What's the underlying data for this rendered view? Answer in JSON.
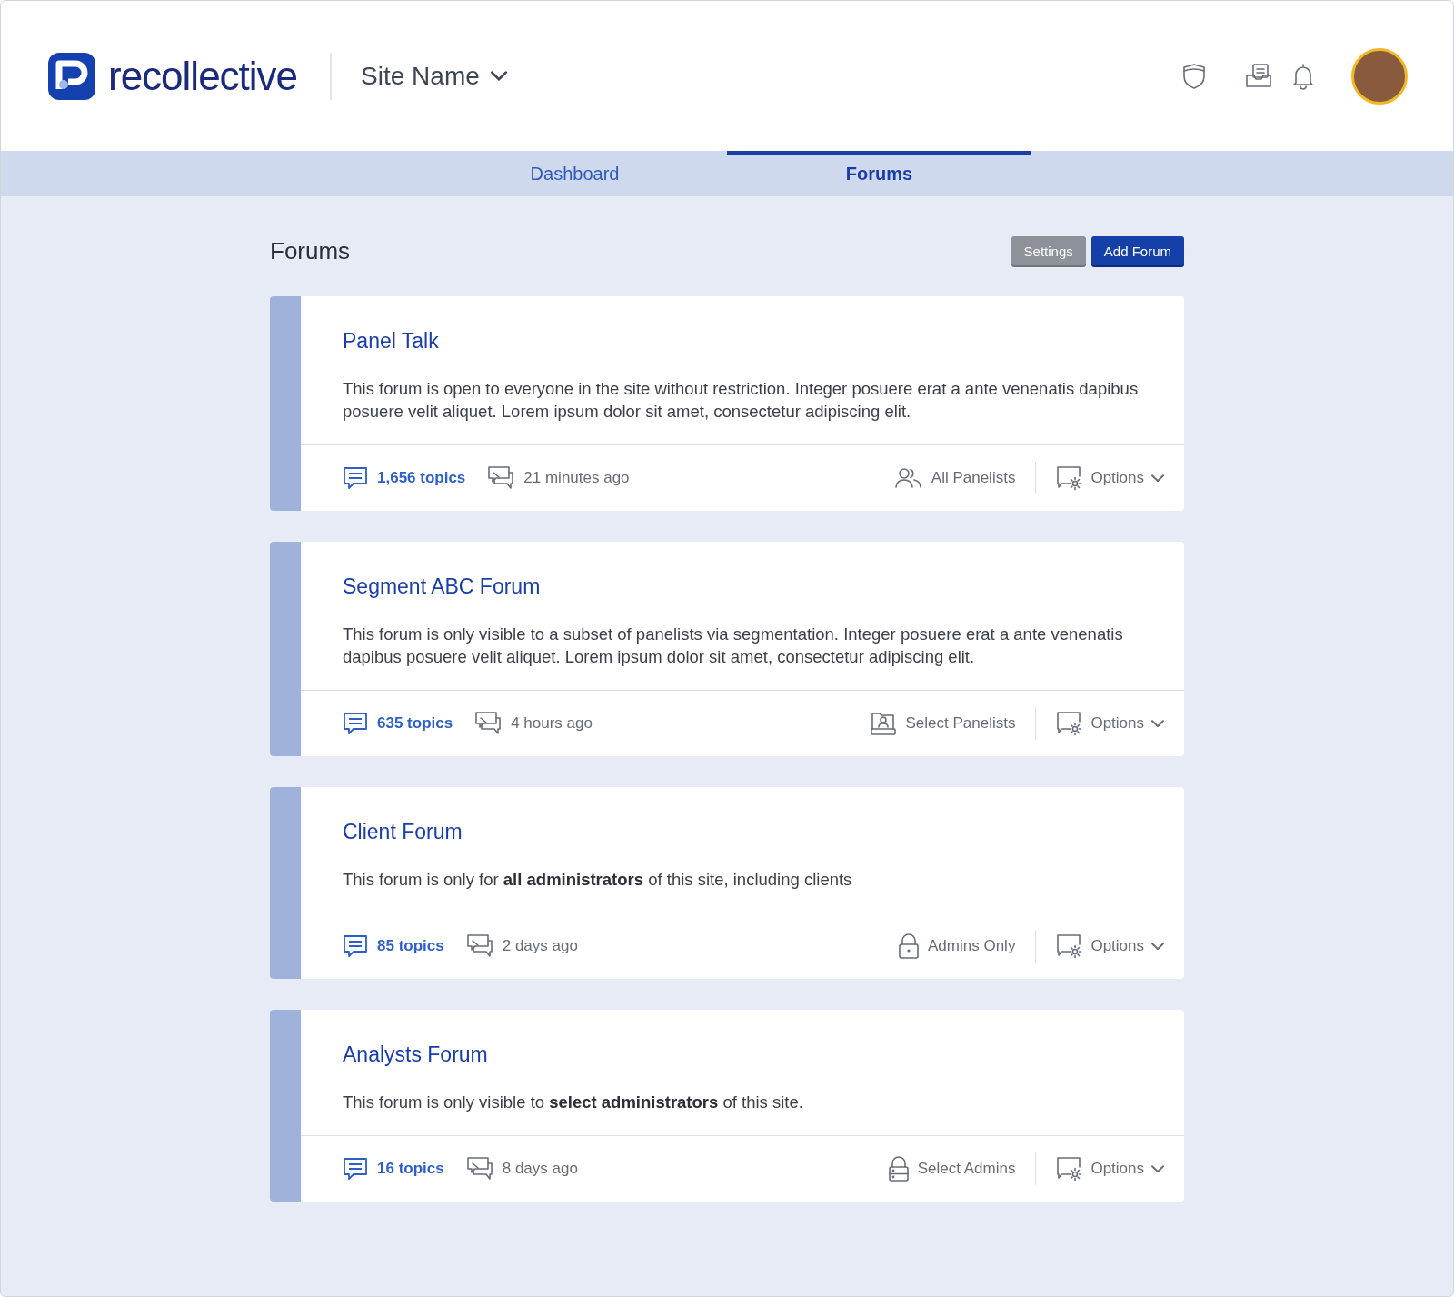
{
  "header": {
    "logo_text": "recollective",
    "site_menu": "Site Name"
  },
  "tabs": [
    {
      "label": "Dashboard",
      "selected": false
    },
    {
      "label": "Forums",
      "selected": true
    }
  ],
  "page": {
    "title": "Forums",
    "buttons": [
      {
        "label": "Settings",
        "kind": "secondary"
      },
      {
        "label": "Add Forum",
        "kind": "primary"
      }
    ]
  },
  "forums": [
    {
      "title": "Panel Talk",
      "description": "This forum is open to everyone in the site without restriction. Integer posuere erat a ante venenatis dapibus posuere velit aliquet. Lorem ipsum dolor sit amet, consectetur adipiscing elit.",
      "topics": "1,656 topics",
      "last_activity": "21 minutes ago",
      "access": {
        "kind": "all-panelists",
        "label": "All Panelists"
      },
      "options": "Options"
    },
    {
      "title": "Segment ABC Forum",
      "description": "This forum is only visible to a subset of panelists via segmentation. Integer posuere erat a ante venenatis dapibus posuere velit aliquet. Lorem ipsum dolor sit amet, consectetur adipiscing elit.",
      "topics": "635 topics",
      "last_activity": "4 hours ago",
      "access": {
        "kind": "select-panelists",
        "label": "Select Panelists"
      },
      "options": "Options"
    },
    {
      "title": "Client Forum",
      "description": "This forum is only for **all administrators** of this site, including clients",
      "topics": "85 topics",
      "last_activity": "2 days ago",
      "access": {
        "kind": "admins-only",
        "label": "Admins Only"
      },
      "options": "Options"
    },
    {
      "title": "Analysts Forum",
      "description": "This forum is only visible to **select administrators** of this site.",
      "topics": "16 topics",
      "last_activity": "8 days ago",
      "access": {
        "kind": "select-admins",
        "label": "Select Admins"
      },
      "options": "Options"
    }
  ]
}
